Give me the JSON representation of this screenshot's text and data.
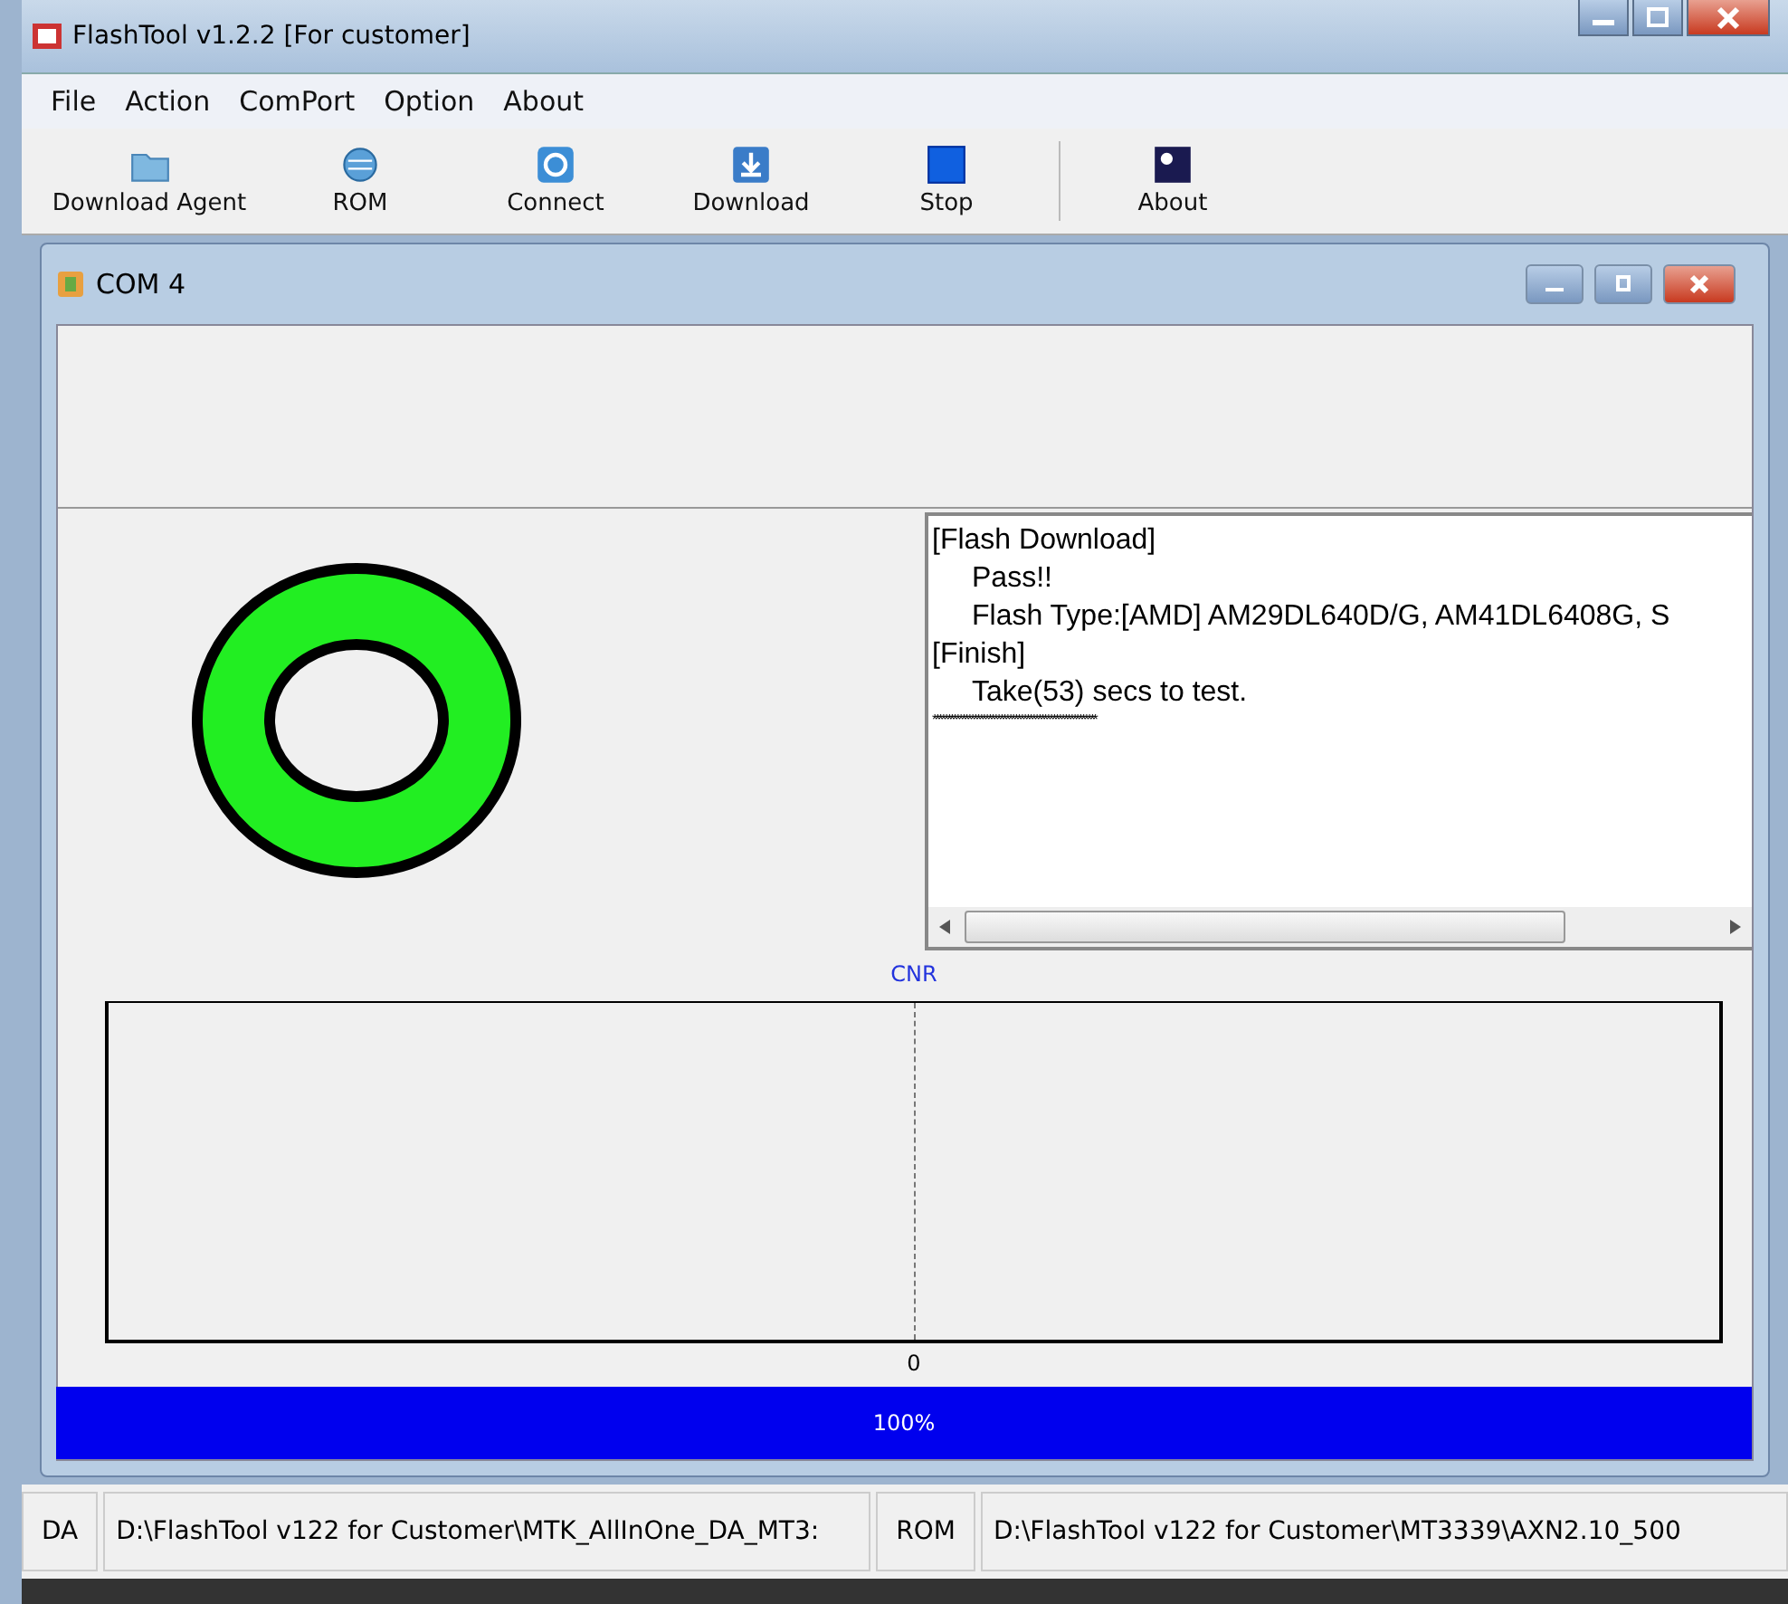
{
  "window": {
    "title": "FlashTool v1.2.2 [For customer]"
  },
  "menu": [
    "File",
    "Action",
    "ComPort",
    "Option",
    "About"
  ],
  "toolbar": [
    {
      "label": "Download Agent",
      "kind": "folder"
    },
    {
      "label": "ROM",
      "kind": "globe"
    },
    {
      "label": "Connect",
      "kind": "connect"
    },
    {
      "label": "Download",
      "kind": "download"
    },
    {
      "label": "Stop",
      "kind": "stop"
    },
    {
      "label": "About",
      "kind": "about"
    }
  ],
  "child_window": {
    "title": "COM 4"
  },
  "log": [
    {
      "text": "[Flash Download]",
      "indent": false
    },
    {
      "text": "Pass!!",
      "indent": true
    },
    {
      "text": "Flash Type:[AMD] AM29DL640D/G, AM41DL6408G, S",
      "indent": true
    },
    {
      "text": "[Finish]",
      "indent": false
    },
    {
      "text": "Take(53) secs to test.",
      "indent": true
    },
    {
      "text": "********************************************************",
      "indent": false
    }
  ],
  "plot": {
    "title": "CNR",
    "x_label": "0"
  },
  "progress": {
    "level": 1.0,
    "reading": "100%"
  },
  "status_bar": [
    {
      "text": "DA",
      "kind": "label"
    },
    {
      "text": "D:\\FlashTool v122 for Customer\\MTK_AllInOne_DA_MT3:",
      "kind": "path"
    },
    {
      "text": "ROM",
      "kind": "label"
    },
    {
      "text": "D:\\FlashTool v122 for Customer\\MT3339\\AXN2.10_500",
      "kind": "path"
    }
  ]
}
